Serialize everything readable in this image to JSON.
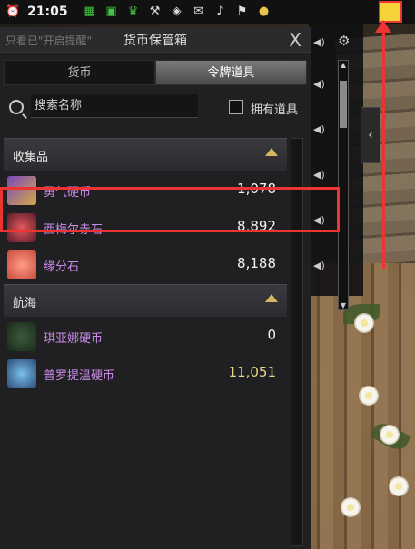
{
  "topbar": {
    "time": "21:05",
    "icons": [
      "alarm-icon",
      "calendar-icon",
      "web-icon",
      "crown-icon",
      "wrench-icon",
      "gift-icon",
      "mail-icon",
      "bell-icon",
      "market-icon",
      "coins-icon",
      "highlighted-event-icon"
    ]
  },
  "panel": {
    "faint_label": "只看已\"开启提醒\"",
    "title": "货币保管箱",
    "close": "X",
    "tabs": [
      {
        "label": "货币"
      },
      {
        "label": "令牌道具"
      }
    ],
    "search_placeholder": "搜索名称",
    "owned_label": "拥有道具"
  },
  "categories": [
    {
      "label": "收集品",
      "items": [
        {
          "name": "勇气硬币",
          "value": "1,078",
          "icon": "courage-coin-icon"
        },
        {
          "name": "西梅尔赤石",
          "value": "8,892",
          "icon": "red-stone-icon"
        },
        {
          "name": "缘分石",
          "value": "8,188",
          "icon": "fate-stone-icon"
        }
      ]
    },
    {
      "label": "航海",
      "items": [
        {
          "name": "琪亚娜硬币",
          "value": "0",
          "icon": "kiana-coin-icon"
        },
        {
          "name": "普罗提温硬币",
          "value": "11,051",
          "icon": "protiwen-coin-icon"
        }
      ]
    }
  ],
  "colors": {
    "accent_red": "#e33333",
    "item_name": "#c88ae8",
    "gold_value": "#e8d98a",
    "chevron": "#d8b563"
  }
}
